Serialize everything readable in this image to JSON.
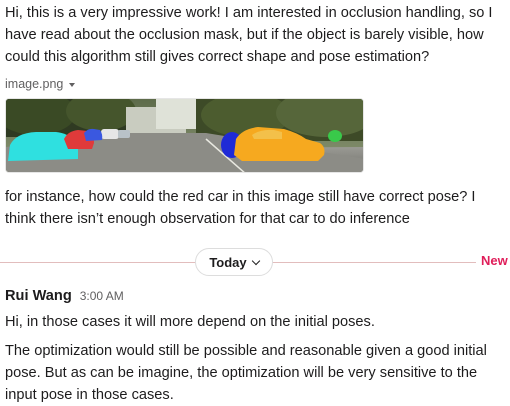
{
  "messages": {
    "question": "Hi, this is a very impressive work! I am interested in occlusion handling, so I have read about the occlusion mask, but if the object is barely visible, how could this algorithm still gives correct shape and pose estimation?",
    "attachment": {
      "filename": "image.png",
      "caret_icon": "caret-down-icon"
    },
    "followup": "for instance, how could the red car in this image still have correct pose? I think there isn’t enough observation for that car to do inference"
  },
  "divider": {
    "day_label": "Today",
    "new_label": "New",
    "new_color": "#e01e5a"
  },
  "reply": {
    "sender": "Rui Wang",
    "time": "3:00 AM",
    "paragraphs": [
      "Hi, in those cases it will more depend on the initial poses.",
      "The optimization would still be possible and reasonable given a good initial pose. But as can be imagine, the optimization will be very sensitive to the input pose in those cases."
    ]
  }
}
